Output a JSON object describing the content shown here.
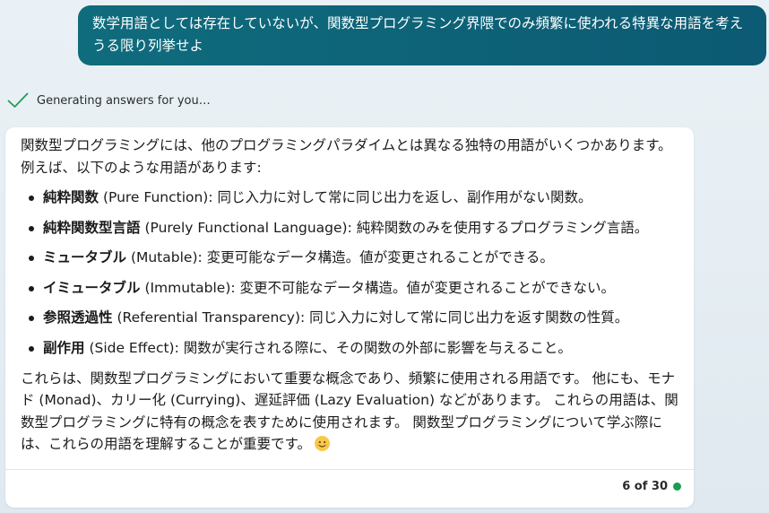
{
  "user_message": "数学用語としては存在していないが、関数型プログラミング界隈でのみ頻繁に使われる特異な用語を考えうる限り列挙せよ",
  "status": {
    "text": "Generating answers for you…",
    "icon": "check-icon",
    "color": "#1f9d55"
  },
  "answer": {
    "intro": "関数型プログラミングには、他のプログラミングパラダイムとは異なる独特の用語がいくつかあります。 例えば、以下のような用語があります:",
    "items": [
      {
        "term": "純粋関数",
        "desc": " (Pure Function): 同じ入力に対して常に同じ出力を返し、副作用がない関数。"
      },
      {
        "term": "純粋関数型言語",
        "desc": " (Purely Functional Language): 純粋関数のみを使用するプログラミング言語。"
      },
      {
        "term": "ミュータブル",
        "desc": " (Mutable): 変更可能なデータ構造。値が変更されることができる。"
      },
      {
        "term": "イミュータブル",
        "desc": " (Immutable): 変更不可能なデータ構造。値が変更されることができない。"
      },
      {
        "term": "参照透過性",
        "desc": " (Referential Transparency): 同じ入力に対して常に同じ出力を返す関数の性質。"
      },
      {
        "term": "副作用",
        "desc": " (Side Effect): 関数が実行される際に、その関数の外部に影響を与えること。"
      }
    ],
    "closing": "これらは、関数型プログラミングにおいて重要な概念であり、頻繁に使用される用語です。 他にも、モナド (Monad)、カリー化 (Currying)、遅延評価 (Lazy Evaluation) などがあります。 これらの用語は、関数型プログラミングに特有の概念を表すために使用されます。 関数型プログラミングについて学ぶ際には、これらの用語を理解することが重要です。",
    "emoji_icon": "smiling-face-emoji"
  },
  "counter": {
    "label": "6 of 30",
    "dot_color": "#1a9c53"
  }
}
